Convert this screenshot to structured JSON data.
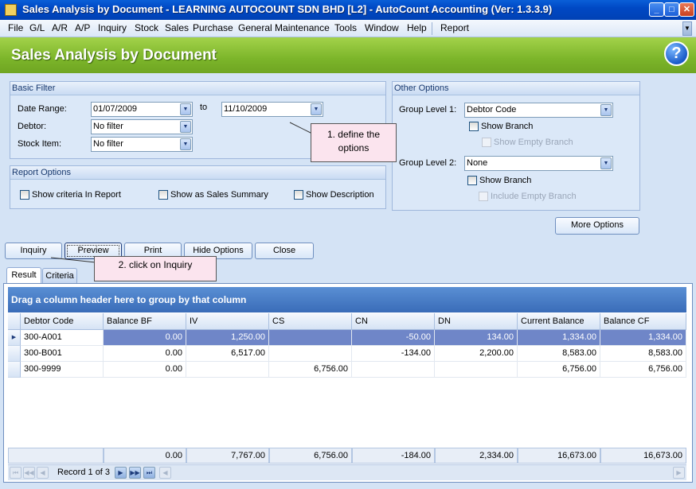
{
  "window": {
    "title": "Sales Analysis by Document - LEARNING AUTOCOUNT SDN BHD [L2] - AutoCount Accounting (Ver: 1.3.3.9)",
    "minimize": "_",
    "maximize": "□",
    "close": "✕"
  },
  "menu": [
    "File",
    "G/L",
    "A/R",
    "A/P",
    "Inquiry",
    "Stock",
    "Sales",
    "Purchase",
    "General Maintenance",
    "Tools",
    "Window",
    "Help",
    "Report"
  ],
  "header": {
    "title": "Sales Analysis by Document",
    "help": "?"
  },
  "basic_filter": {
    "heading": "Basic Filter",
    "date_range_label": "Date Range:",
    "date_from": "01/07/2009",
    "to_label": "to",
    "date_to": "11/10/2009",
    "debtor_label": "Debtor:",
    "debtor_value": "No filter",
    "stock_label": "Stock Item:",
    "stock_value": "No filter"
  },
  "report_options": {
    "heading": "Report Options",
    "show_criteria": "Show criteria In Report",
    "show_summary": "Show as Sales Summary",
    "show_description": "Show Description"
  },
  "other_options": {
    "heading": "Other Options",
    "group1_label": "Group Level 1:",
    "group1_value": "Debtor Code",
    "show_branch_1": "Show Branch",
    "show_empty_branch": "Show Empty Branch",
    "group2_label": "Group Level 2:",
    "group2_value": "None",
    "show_branch_2": "Show Branch",
    "include_empty_branch": "Include Empty Branch"
  },
  "more_options": "More Options",
  "callouts": {
    "define": "1. define the options",
    "inquiry": "2. click on Inquiry"
  },
  "actions": [
    "Inquiry",
    "Preview",
    "Print",
    "Hide Options",
    "Close"
  ],
  "tabs": [
    "Result",
    "Criteria"
  ],
  "grid": {
    "group_hint": "Drag a column header here to group by that column",
    "columns": [
      "Debtor Code",
      "Balance BF",
      "IV",
      "CS",
      "CN",
      "DN",
      "Current Balance",
      "Balance CF"
    ],
    "rows": [
      [
        "300-A001",
        "0.00",
        "1,250.00",
        "",
        "-50.00",
        "134.00",
        "1,334.00",
        "1,334.00"
      ],
      [
        "300-B001",
        "0.00",
        "6,517.00",
        "",
        "-134.00",
        "2,200.00",
        "8,583.00",
        "8,583.00"
      ],
      [
        "300-9999",
        "0.00",
        "",
        "6,756.00",
        "",
        "",
        "6,756.00",
        "6,756.00"
      ]
    ],
    "totals": [
      "0.00",
      "7,767.00",
      "6,756.00",
      "-184.00",
      "2,334.00",
      "16,673.00",
      "16,673.00"
    ],
    "record_text": "Record 1 of 3"
  }
}
